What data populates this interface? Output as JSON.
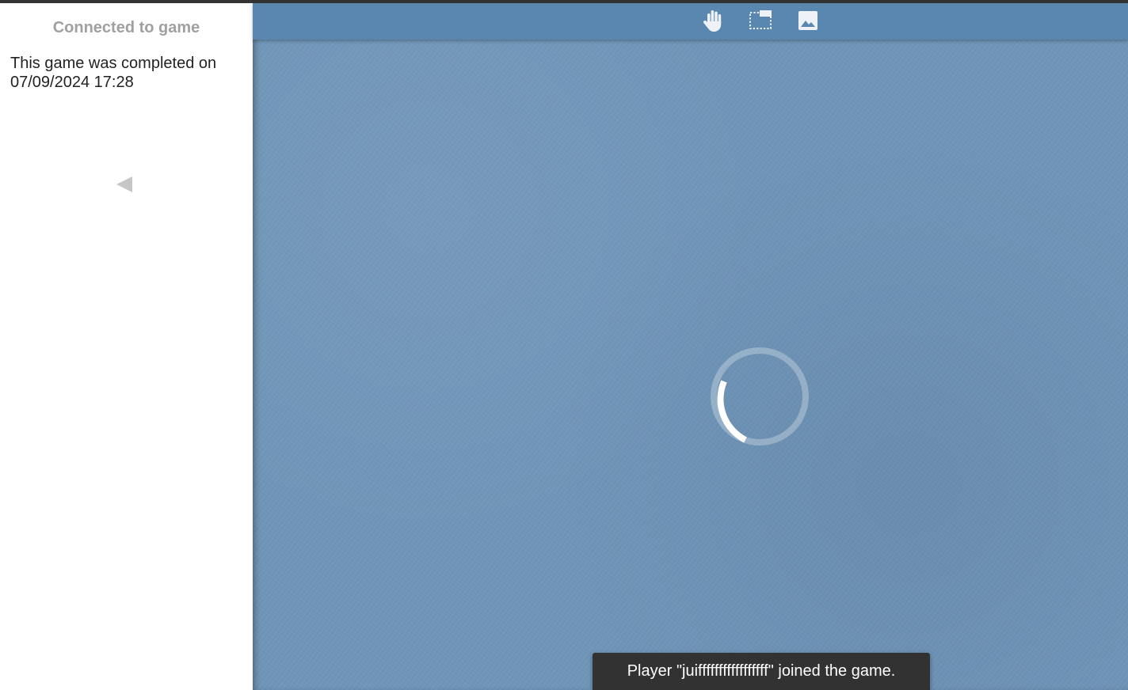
{
  "sidebar": {
    "title": "Connected to game",
    "completed_message": "This game was completed on 07/09/2024 17:28",
    "collapse_icon": "triangle-left-icon"
  },
  "toolbar": {
    "tools": [
      {
        "id": "hand",
        "icon": "hand-icon"
      },
      {
        "id": "select",
        "icon": "dashed-selection-icon"
      },
      {
        "id": "image",
        "icon": "image-icon"
      }
    ]
  },
  "board": {
    "loading_indicator": "spinner"
  },
  "toast": {
    "message": "Player \"juifffffffffffffffff\" joined the game."
  },
  "colors": {
    "board": "#6f95b8",
    "toolbar": "#5a87b0",
    "sidebar": "#ffffff",
    "toast": "#323232"
  }
}
